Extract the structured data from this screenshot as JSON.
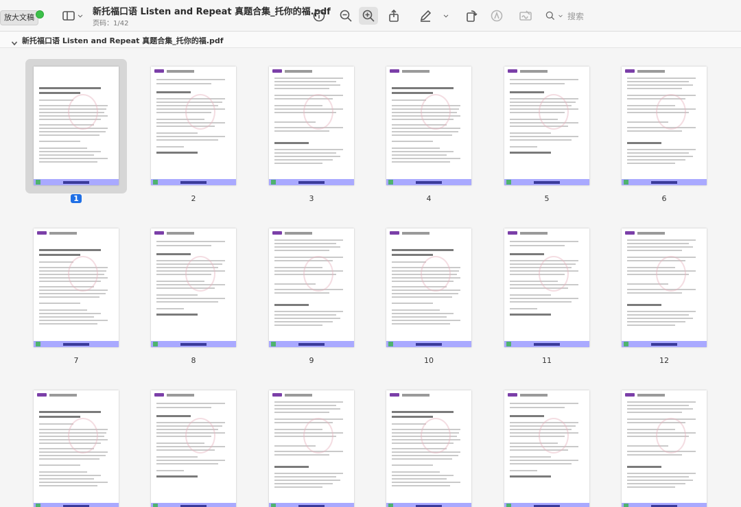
{
  "toolbar": {
    "zoom_badge": "放大文稿",
    "doc_title": "新托福口语 Listen and Repeat 真题合集_托你的福.pdf",
    "page_indicator": "页码：1/42",
    "search_placeholder": "搜索",
    "icons": [
      "sidebar-icon",
      "chevron-down-icon",
      "info-icon",
      "zoom-out-icon",
      "zoom-in-icon",
      "share-icon",
      "markup-pen-icon",
      "chevron-down-icon",
      "rotate-icon",
      "highlight-icon",
      "signature-icon",
      "search-icon"
    ]
  },
  "section": {
    "title": "新托福口语 Listen and Repeat 真题合集_托你的福.pdf"
  },
  "pages": [
    {
      "num": "1"
    },
    {
      "num": "2"
    },
    {
      "num": "3"
    },
    {
      "num": "4"
    },
    {
      "num": "5"
    },
    {
      "num": "6"
    },
    {
      "num": "7"
    },
    {
      "num": "8"
    },
    {
      "num": "9"
    },
    {
      "num": "10"
    },
    {
      "num": "11"
    },
    {
      "num": "12"
    },
    {
      "num": ""
    },
    {
      "num": ""
    },
    {
      "num": ""
    },
    {
      "num": ""
    },
    {
      "num": ""
    },
    {
      "num": ""
    }
  ],
  "selected_page": "1",
  "colors": {
    "accent": "#1f6fe5",
    "page_footer": "#a9a9ff",
    "logo": "#7b3fa8"
  }
}
